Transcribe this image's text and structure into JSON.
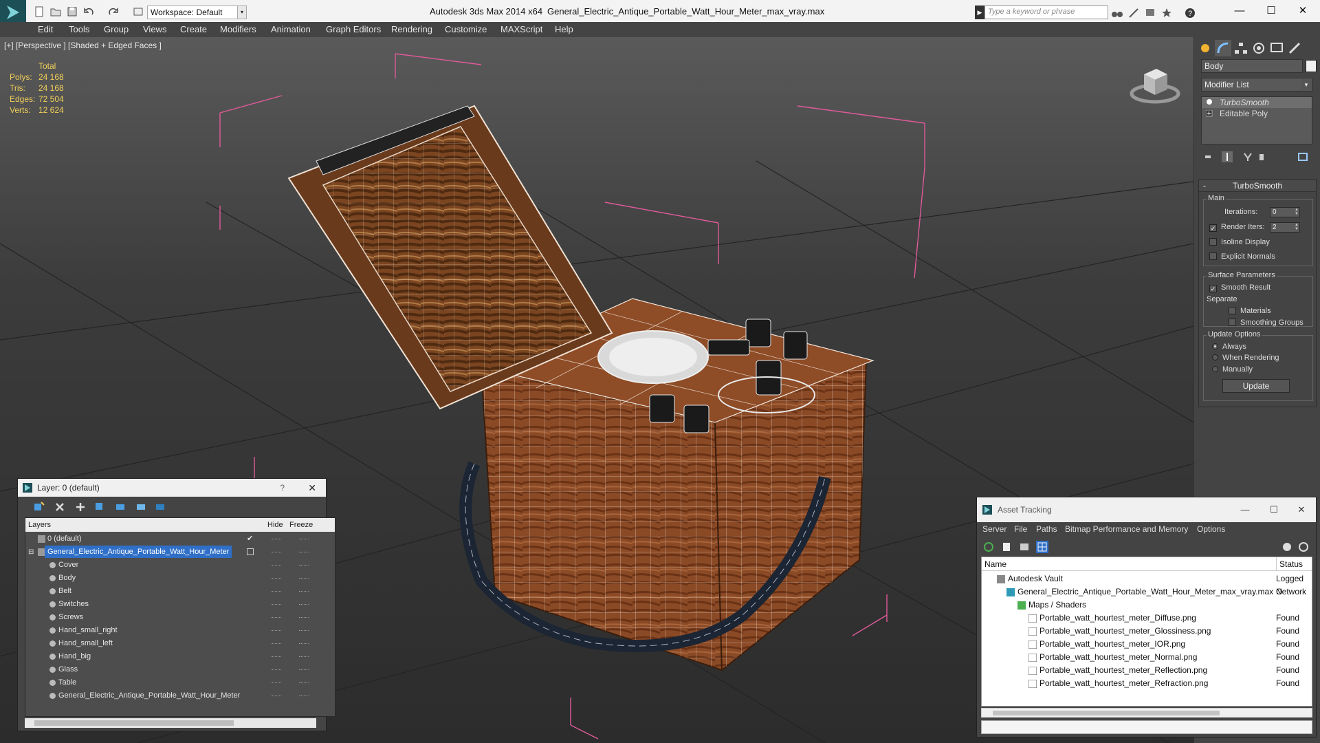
{
  "titlebar": {
    "workspace": "Workspace: Default",
    "app_title": "Autodesk 3ds Max  2014 x64",
    "file_title": "General_Electric_Antique_Portable_Watt_Hour_Meter_max_vray.max",
    "search_placeholder": "Type a keyword or phrase"
  },
  "menu": [
    "Edit",
    "Tools",
    "Group",
    "Views",
    "Create",
    "Modifiers",
    "Animation",
    "Graph Editors",
    "Rendering",
    "Customize",
    "MAXScript",
    "Help"
  ],
  "viewport": {
    "label": "[+] [Perspective ] [Shaded + Edged Faces ]",
    "stats": {
      "header": "Total",
      "rows": [
        {
          "label": "Polys:",
          "value": "24 168"
        },
        {
          "label": "Tris:",
          "value": "24 168"
        },
        {
          "label": "Edges:",
          "value": "72 504"
        },
        {
          "label": "Verts:",
          "value": "12 624"
        }
      ]
    }
  },
  "command_panel": {
    "object_name": "Body",
    "modifier_list": "Modifier List",
    "stack": [
      "TurboSmooth",
      "Editable Poly"
    ],
    "rollout": {
      "title": "TurboSmooth",
      "main": "Main",
      "iterations_label": "Iterations:",
      "iterations_value": "0",
      "render_iters_label": "Render Iters:",
      "render_iters_value": "2",
      "isoline": "Isoline Display",
      "explicit_normals": "Explicit Normals",
      "surface_params": "Surface Parameters",
      "smooth_result": "Smooth Result",
      "separate": "Separate",
      "materials": "Materials",
      "smoothing_groups": "Smoothing Groups",
      "update_options": "Update Options",
      "always": "Always",
      "when_rendering": "When Rendering",
      "manually": "Manually",
      "update_button": "Update"
    }
  },
  "layer_dialog": {
    "title": "Layer: 0 (default)",
    "help": "?",
    "columns": {
      "layers": "Layers",
      "hide": "Hide",
      "freeze": "Freeze"
    },
    "rows": [
      {
        "name": "0 (default)",
        "level": 0
      },
      {
        "name": "General_Electric_Antique_Portable_Watt_Hour_Meter",
        "level": 0
      },
      {
        "name": "Cover",
        "level": 1
      },
      {
        "name": "Body",
        "level": 1
      },
      {
        "name": "Belt",
        "level": 1
      },
      {
        "name": "Switches",
        "level": 1
      },
      {
        "name": "Screws",
        "level": 1
      },
      {
        "name": "Hand_small_right",
        "level": 1
      },
      {
        "name": "Hand_small_left",
        "level": 1
      },
      {
        "name": "Hand_big",
        "level": 1
      },
      {
        "name": "Glass",
        "level": 1
      },
      {
        "name": "Table",
        "level": 1
      },
      {
        "name": "General_Electric_Antique_Portable_Watt_Hour_Meter",
        "level": 1
      }
    ]
  },
  "asset_dialog": {
    "title": "Asset Tracking",
    "menu": [
      "Server",
      "File",
      "Paths",
      "Bitmap Performance and Memory",
      "Options"
    ],
    "columns": {
      "name": "Name",
      "status": "Status"
    },
    "rows": [
      {
        "name": "Autodesk Vault",
        "status": "Logged O",
        "level": 0
      },
      {
        "name": "General_Electric_Antique_Portable_Watt_Hour_Meter_max_vray.max",
        "status": "Network",
        "level": 1
      },
      {
        "name": "Maps / Shaders",
        "status": "",
        "level": 2
      },
      {
        "name": "Portable_watt_hourtest_meter_Diffuse.png",
        "status": "Found",
        "level": 3
      },
      {
        "name": "Portable_watt_hourtest_meter_Glossiness.png",
        "status": "Found",
        "level": 3
      },
      {
        "name": "Portable_watt_hourtest_meter_IOR.png",
        "status": "Found",
        "level": 3
      },
      {
        "name": "Portable_watt_hourtest_meter_Normal.png",
        "status": "Found",
        "level": 3
      },
      {
        "name": "Portable_watt_hourtest_meter_Reflection.png",
        "status": "Found",
        "level": 3
      },
      {
        "name": "Portable_watt_hourtest_meter_Refraction.png",
        "status": "Found",
        "level": 3
      }
    ]
  },
  "colors": {
    "accent": "#2f6fc7",
    "stats": "#f2d05a",
    "wood": "#8a4a28",
    "bbox": "#e05a9a"
  }
}
